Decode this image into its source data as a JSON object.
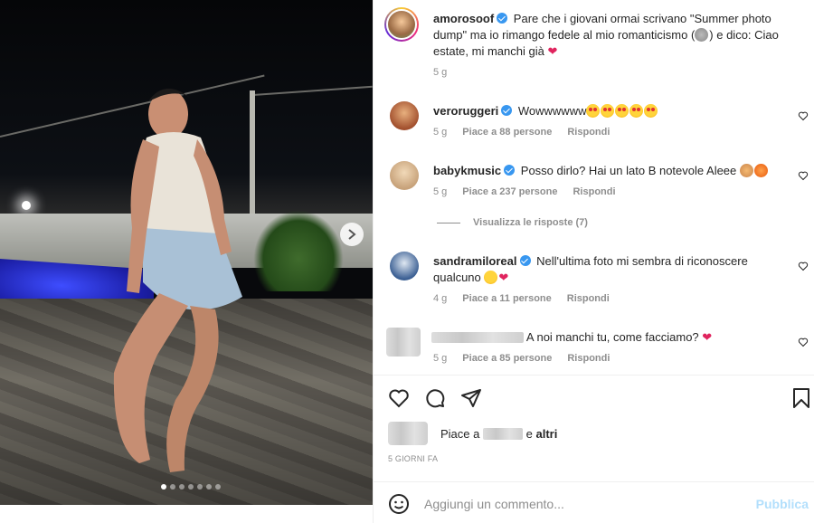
{
  "post": {
    "author": "amorosoof",
    "caption": "Pare che i giovani ormai scrivano \"Summer photo dump\" ma io rimango fedele al mio romanticismo (",
    "caption_tail": ") e dico: Ciao estate, mi manchi già",
    "caption_time": "5 g"
  },
  "comments": [
    {
      "user": "veroruggeri",
      "text": "Wowwwwww",
      "time": "5 g",
      "likes": "Piace a 88 persone",
      "reply": "Rispondi"
    },
    {
      "user": "babykmusic",
      "text": "Posso dirlo? Hai un lato B notevole Aleee",
      "time": "5 g",
      "likes": "Piace a 237 persone",
      "reply": "Rispondi",
      "view_replies": "Visualizza le risposte (7)"
    },
    {
      "user": "sandramiloreal",
      "text": "Nell'ultima foto mi sembra di riconoscere qualcuno",
      "time": "4 g",
      "likes": "Piace a 11 persone",
      "reply": "Rispondi"
    },
    {
      "user": "",
      "text": "A noi manchi tu, come facciamo?",
      "time": "5 g",
      "likes": "Piace a 85 persone",
      "reply": "Rispondi"
    }
  ],
  "likes_bar": {
    "prefix": "Piace a",
    "mid": "e",
    "suffix": "altri"
  },
  "post_date": "5 GIORNI FA",
  "add_comment": {
    "placeholder": "Aggiungi un commento...",
    "publish": "Pubblica"
  },
  "colors": {
    "link": "#0095f6",
    "publish_disabled": "#b2dffc",
    "heart": "#e0245e",
    "verified": "#3897f0"
  },
  "icons": [
    "verified-badge-icon",
    "like-icon",
    "comment-icon",
    "share-icon",
    "save-icon",
    "emoji-icon",
    "next-arrow-icon"
  ]
}
